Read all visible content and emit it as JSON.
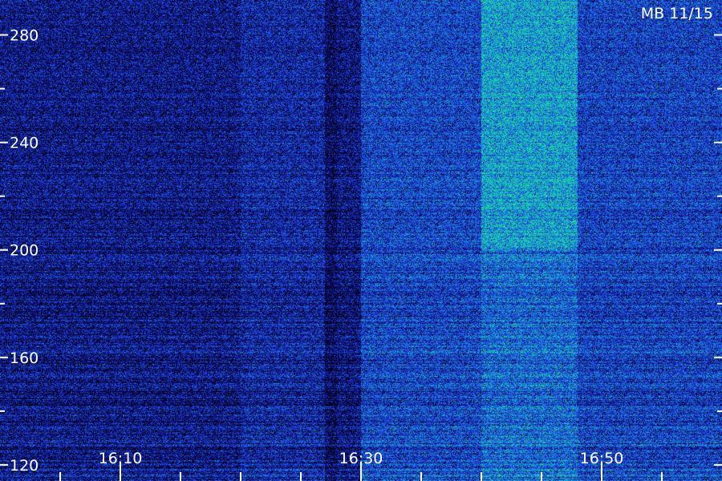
{
  "stamp": "MB 11/15",
  "chart_data": {
    "type": "heatmap",
    "title": "",
    "xlabel": "",
    "ylabel": "",
    "x_range": [
      "16:00",
      "16:60"
    ],
    "y_range": [
      114,
      293
    ],
    "x_ticks": [
      "16:10",
      "16:30",
      "16:50"
    ],
    "x_minor_ticks": [
      "16:05",
      "16:10",
      "16:15",
      "16:20",
      "16:25",
      "16:30",
      "16:35",
      "16:40",
      "16:45",
      "16:50",
      "16:55"
    ],
    "y_ticks": [
      120,
      160,
      200,
      240,
      280
    ],
    "y_minor_ticks": [
      140,
      180,
      220,
      260
    ],
    "colormap": [
      "#000010",
      "#0a0e70",
      "#1d32cf",
      "#1f66e6",
      "#14a8c8",
      "#1fe69a"
    ],
    "intensity_regions": [
      {
        "x": [
          "16:00",
          "16:20"
        ],
        "y": [
          114,
          293
        ],
        "level": 0.3
      },
      {
        "x": [
          "16:20",
          "16:27"
        ],
        "y": [
          114,
          293
        ],
        "level": 0.38
      },
      {
        "x": [
          "16:30",
          "16:40"
        ],
        "y": [
          114,
          293
        ],
        "level": 0.52
      },
      {
        "x": [
          "16:40",
          "16:48"
        ],
        "y": [
          114,
          293
        ],
        "level": 0.64
      },
      {
        "x": [
          "16:40",
          "16:48"
        ],
        "y": [
          200,
          293
        ],
        "level": 0.82
      },
      {
        "x": [
          "16:48",
          "16:60"
        ],
        "y": [
          114,
          293
        ],
        "level": 0.5
      }
    ],
    "dark_lane": {
      "x": [
        "16:27",
        "16:28"
      ]
    }
  }
}
